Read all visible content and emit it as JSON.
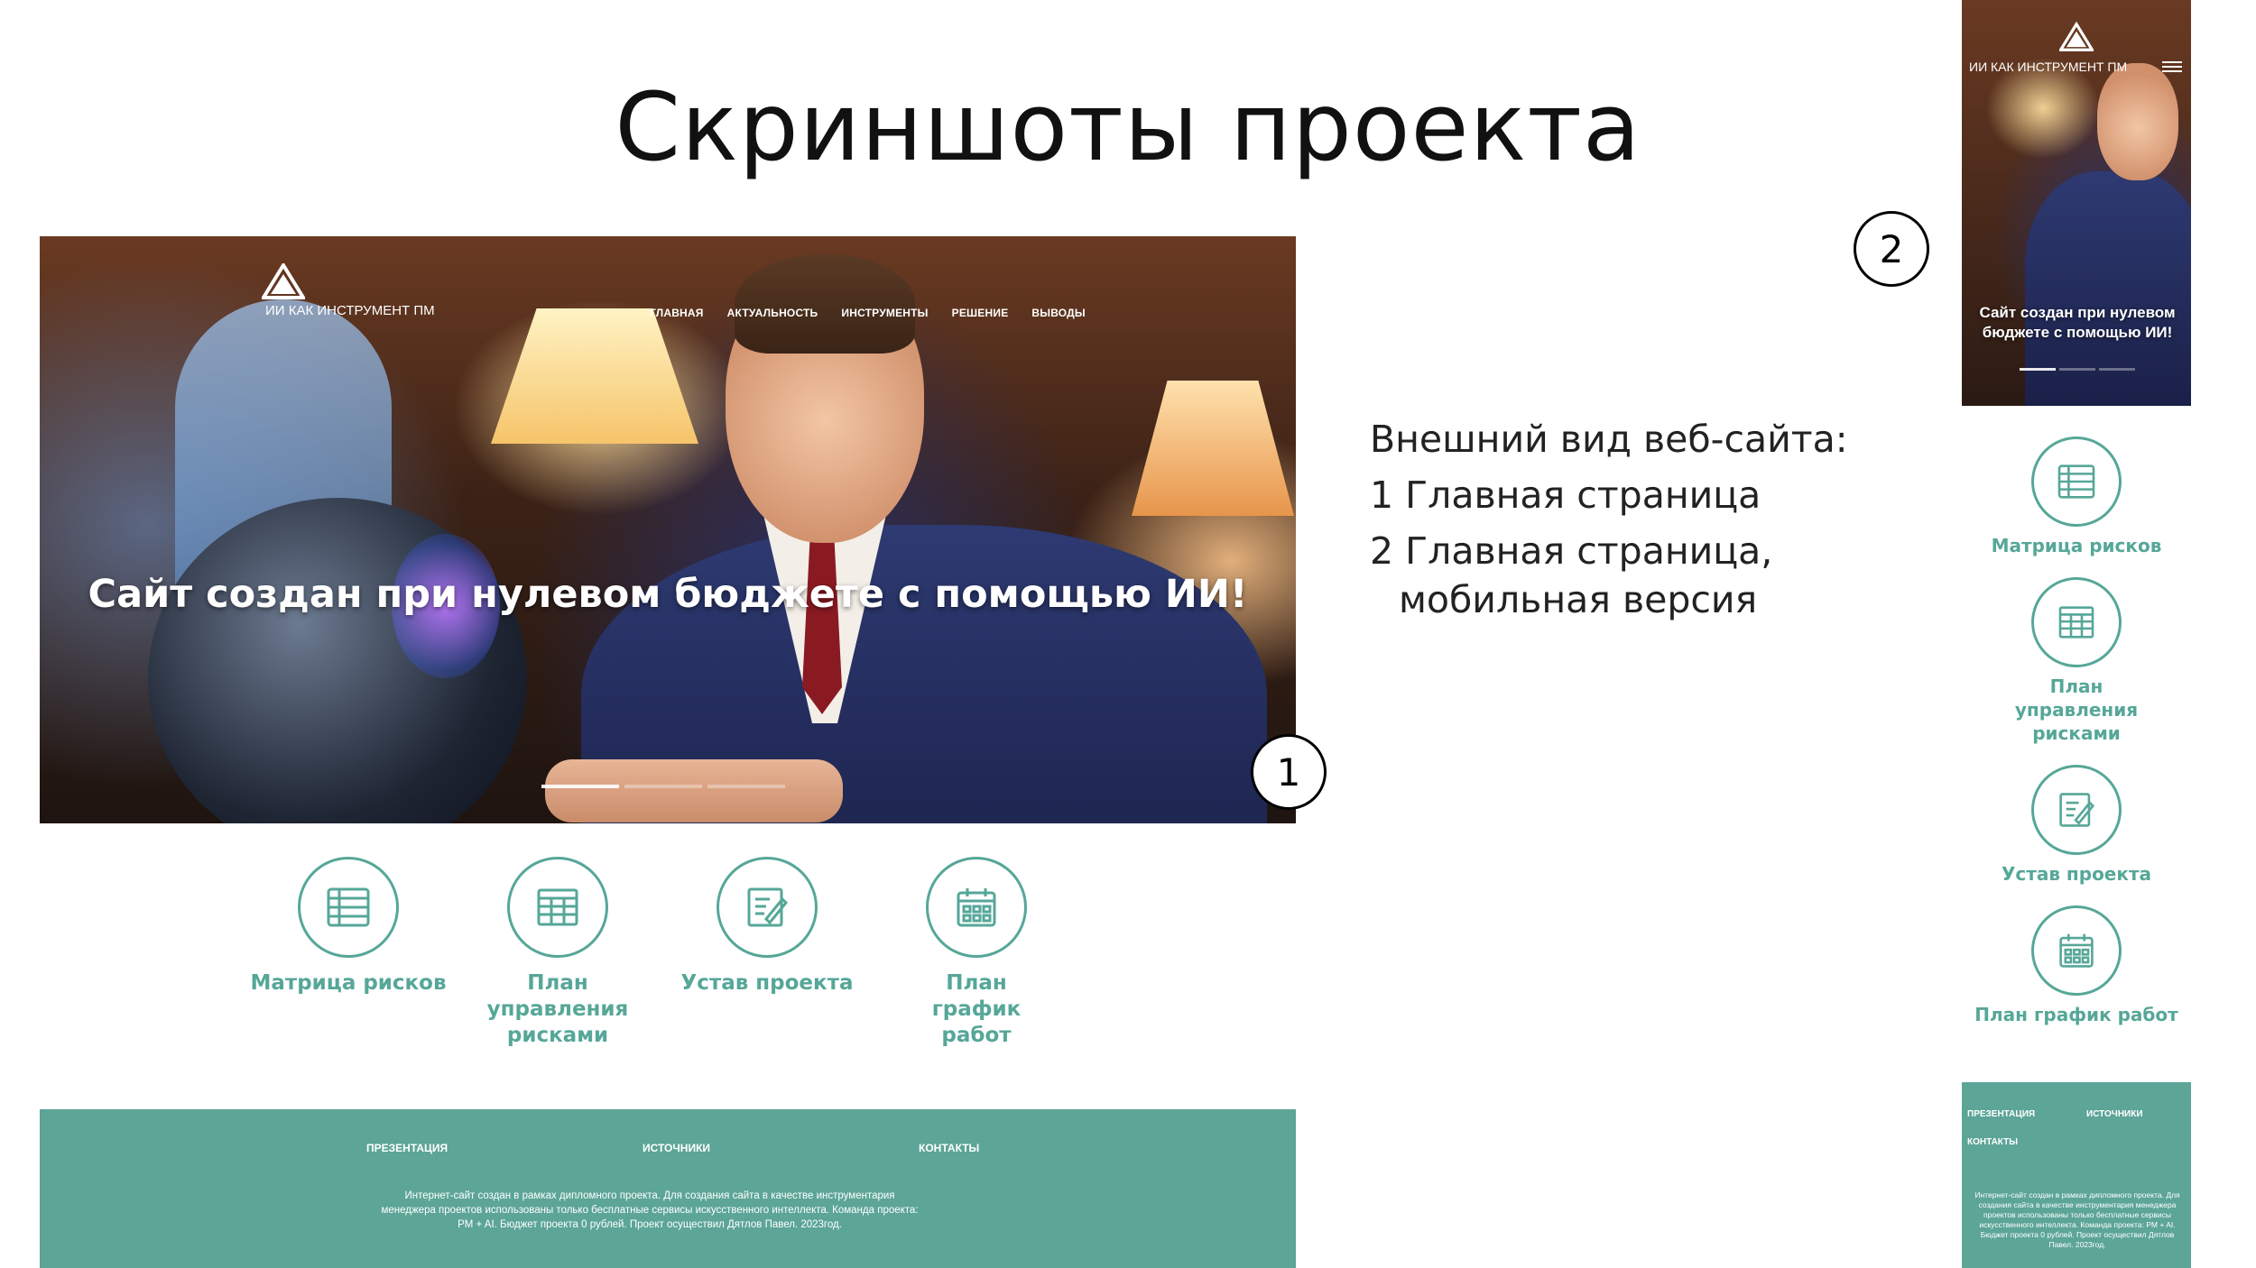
{
  "slide": {
    "title": "Скриншоты проекта"
  },
  "desktop": {
    "brand": "ИИ КАК ИНСТРУМЕНТ ПМ",
    "nav": [
      "ГЛАВНАЯ",
      "АКТУАЛЬНОСТЬ",
      "ИНСТРУМЕНТЫ",
      "РЕШЕНИЕ",
      "ВЫВОДЫ"
    ],
    "headline": "Сайт создан при нулевом бюджете с помощью ИИ!",
    "marker": "1",
    "features": [
      {
        "label": "Матрица рисков",
        "icon": "list-icon"
      },
      {
        "label": "План управления рисками",
        "icon": "table-icon"
      },
      {
        "label": "Устав проекта",
        "icon": "edit-icon"
      },
      {
        "label": "План график работ",
        "icon": "calendar-icon"
      }
    ],
    "footer": {
      "links": [
        "ПРЕЗЕНТАЦИЯ",
        "ИСТОЧНИКИ",
        "КОНТАКТЫ"
      ],
      "text": "Интернет-сайт создан в рамках дипломного проекта. Для создания сайта в качестве инструментария менеджера проектов использованы только бесплатные сервисы искусственного интеллекта. Команда проекта: PM + AI. Бюджет проекта 0 рублей. Проект осуществил Дятлов Павел. 2023год."
    }
  },
  "description": {
    "heading": "Внешний вид веб-сайта:",
    "item1": "1 Главная страница",
    "item2": "2 Главная страница,",
    "item2_cont": "мобильная версия"
  },
  "mobile": {
    "brand": "ИИ КАК ИНСТРУМЕНТ ПМ",
    "headline": "Сайт создан при нулевом бюджете с помощью ИИ!",
    "marker": "2",
    "features": [
      {
        "label": "Матрица рисков",
        "icon": "list-icon"
      },
      {
        "label": "План управления рисками",
        "icon": "table-icon"
      },
      {
        "label": "Устав проекта",
        "icon": "edit-icon"
      },
      {
        "label": "План график работ",
        "icon": "calendar-icon"
      }
    ],
    "footer": {
      "links": [
        "ПРЕЗЕНТАЦИЯ",
        "ИСТОЧНИКИ",
        "КОНТАКТЫ"
      ],
      "text": "Интернет-сайт создан в рамках дипломного проекта. Для создания сайта в качестве инструментария менеджера проектов использованы только бесплатные сервисы искусственного интеллекта. Команда проекта: PM + AI. Бюджет проекта 0 рублей. Проект осуществил Дятлов Павел. 2023год."
    }
  },
  "colors": {
    "accent": "#56a798",
    "footer_bg": "#5ca597"
  }
}
